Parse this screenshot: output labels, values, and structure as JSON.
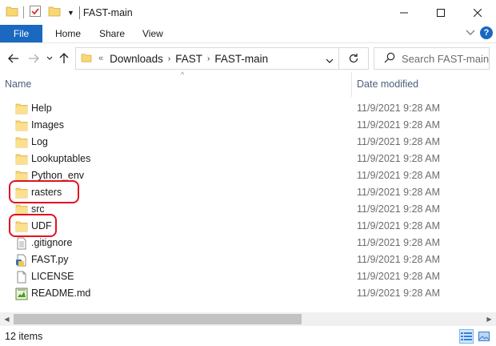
{
  "window": {
    "title": "FAST-main",
    "controls": {
      "minimize": "–",
      "maximize": "☐",
      "close": "✕"
    }
  },
  "ribbon": {
    "tabs": [
      "File",
      "Home",
      "Share",
      "View"
    ]
  },
  "address": {
    "overflow": "«",
    "breadcrumbs": [
      "Downloads",
      "FAST",
      "FAST-main"
    ],
    "search_placeholder": "Search FAST-main"
  },
  "columns": {
    "name": "Name",
    "date_modified": "Date modified"
  },
  "files": [
    {
      "name": "Help",
      "date": "11/9/2021 9:28 AM",
      "icon": "folder-icon",
      "highlighted": false
    },
    {
      "name": "Images",
      "date": "11/9/2021 9:28 AM",
      "icon": "folder-icon",
      "highlighted": false
    },
    {
      "name": "Log",
      "date": "11/9/2021 9:28 AM",
      "icon": "folder-icon",
      "highlighted": false
    },
    {
      "name": "Lookuptables",
      "date": "11/9/2021 9:28 AM",
      "icon": "folder-icon",
      "highlighted": false
    },
    {
      "name": "Python_env",
      "date": "11/9/2021 9:28 AM",
      "icon": "folder-icon",
      "highlighted": false
    },
    {
      "name": "rasters",
      "date": "11/9/2021 9:28 AM",
      "icon": "folder-icon",
      "highlighted": true
    },
    {
      "name": "src",
      "date": "11/9/2021 9:28 AM",
      "icon": "folder-icon",
      "highlighted": false
    },
    {
      "name": "UDF",
      "date": "11/9/2021 9:28 AM",
      "icon": "folder-icon",
      "highlighted": true
    },
    {
      "name": ".gitignore",
      "date": "11/9/2021 9:28 AM",
      "icon": "text-file-icon",
      "highlighted": false
    },
    {
      "name": "FAST.py",
      "date": "11/9/2021 9:28 AM",
      "icon": "python-file-icon",
      "highlighted": false
    },
    {
      "name": "LICENSE",
      "date": "11/9/2021 9:28 AM",
      "icon": "blank-file-icon",
      "highlighted": false
    },
    {
      "name": "README.md",
      "date": "11/9/2021 9:28 AM",
      "icon": "markdown-file-icon",
      "highlighted": false
    }
  ],
  "status": {
    "item_count": "12 items"
  },
  "colors": {
    "accent": "#1a68c0",
    "folder": "#f8d775",
    "highlight": "#e0141e",
    "header_text": "#4c607a"
  }
}
